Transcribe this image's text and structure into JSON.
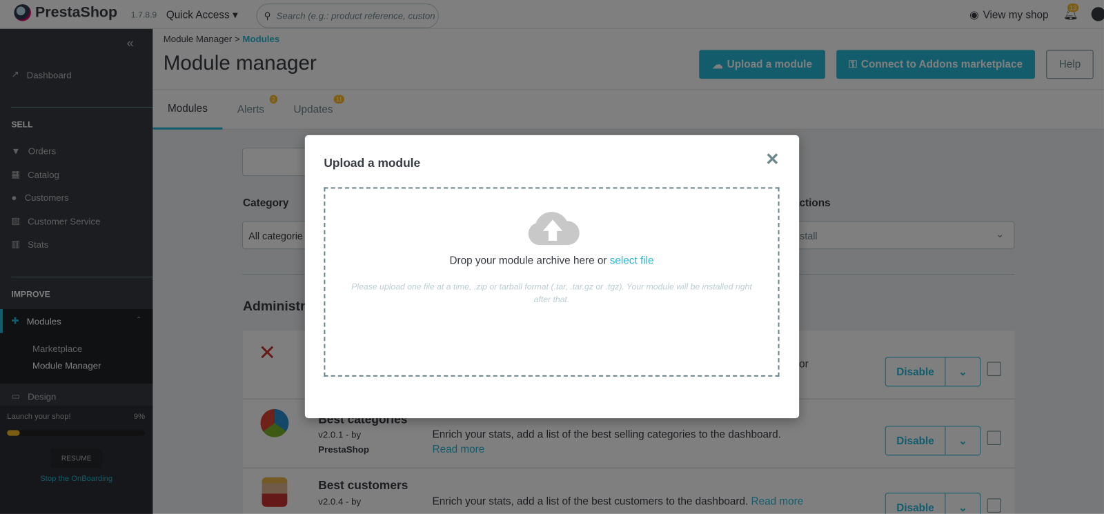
{
  "header": {
    "brand": "PrestaShop",
    "version": "1.7.8.9",
    "quick_access": "Quick Access",
    "search_placeholder": "Search (e.g.: product reference, custon",
    "view_shop": "View my shop",
    "notifications": "13"
  },
  "sidebar": {
    "dashboard": "Dashboard",
    "sell_title": "SELL",
    "sell_items": [
      "Orders",
      "Catalog",
      "Customers",
      "Customer Service",
      "Stats"
    ],
    "improve_title": "IMPROVE",
    "modules": "Modules",
    "sub_items": [
      "Marketplace",
      "Module Manager"
    ],
    "design": "Design",
    "onboarding": {
      "label": "Launch your shop!",
      "percent_label": "9%",
      "progress": 9,
      "resume": "RESUME",
      "stop": "Stop the OnBoarding"
    }
  },
  "page": {
    "breadcrumb": [
      "Module Manager",
      "Modules"
    ],
    "breadcrumb_sep": ">",
    "title": "Module manager",
    "upload_button": "Upload a module",
    "connect_button": "Connect to Addons marketplace",
    "help_button": "Help",
    "tabs": [
      {
        "label": "Modules",
        "active": true
      },
      {
        "label": "Alerts",
        "badge": "2"
      },
      {
        "label": "Updates",
        "badge": "11"
      }
    ],
    "category_label": "Category",
    "category_value": "All categorie",
    "bulk_label": "actions",
    "bulk_value": "stall",
    "section_title": "Administr",
    "modules": [
      {
        "name": "",
        "version": "",
        "author": "",
        "desc": "or",
        "action": "Disable"
      },
      {
        "name": "Best categories",
        "version": "v2.0.1 - by",
        "author": "PrestaShop",
        "desc": "Enrich your stats, add a list of the best selling categories to the dashboard.",
        "read_more": "Read more",
        "action": "Disable"
      },
      {
        "name": "Best customers",
        "version": "v2.0.4 - by",
        "author": "",
        "desc": "Enrich your stats, add a list of the best customers to the dashboard.",
        "read_more": "Read more",
        "action": "Disable"
      }
    ]
  },
  "modal": {
    "title": "Upload a module",
    "drop_text": "Drop your module archive here or",
    "select_file": "select file",
    "help": "Please upload one file at a time, .zip or tarball format (.tar, .tar.gz or .tgz). Your module will be installed right after that."
  },
  "colors": {
    "accent": "#25b9d7",
    "sidebar": "#363a41",
    "badge": "#fbbb22"
  }
}
